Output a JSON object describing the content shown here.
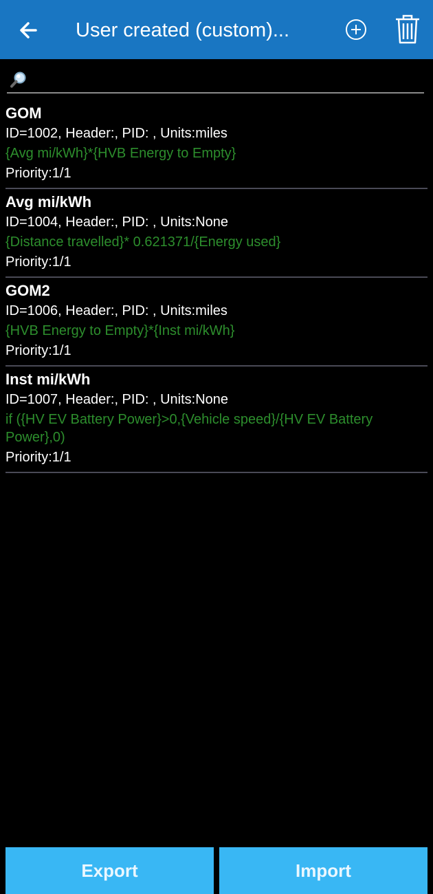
{
  "header": {
    "title": "User created (custom)...",
    "back_icon": "arrow-left-icon",
    "add_icon": "plus-circle-icon",
    "delete_icon": "trash-icon",
    "background_color": "#1976c2"
  },
  "search": {
    "placeholder": "",
    "value": "",
    "icon": "magnifier-icon"
  },
  "items": [
    {
      "name": "GOM",
      "info": "ID=1002, Header:, PID: , Units:miles",
      "formula": "{Avg mi/kWh}*{HVB Energy to Empty}",
      "priority": "Priority:1/1"
    },
    {
      "name": "Avg mi/kWh",
      "info": "ID=1004, Header:, PID: , Units:None",
      "formula": "{Distance travelled}* 0.621371/{Energy used}",
      "priority": "Priority:1/1"
    },
    {
      "name": "GOM2",
      "info": "ID=1006, Header:, PID: , Units:miles",
      "formula": "{HVB Energy to Empty}*{Inst mi/kWh}",
      "priority": "Priority:1/1"
    },
    {
      "name": "Inst mi/kWh",
      "info": "ID=1007, Header:, PID: , Units:None",
      "formula": "if ({HV EV Battery Power}>0,{Vehicle speed}/{HV EV Battery Power},0)",
      "priority": "Priority:1/1"
    }
  ],
  "footer": {
    "export_label": "Export",
    "import_label": "Import",
    "button_color": "#39b7f4"
  },
  "colors": {
    "formula_text": "#2d8e2d",
    "divider": "#4a4a56"
  }
}
